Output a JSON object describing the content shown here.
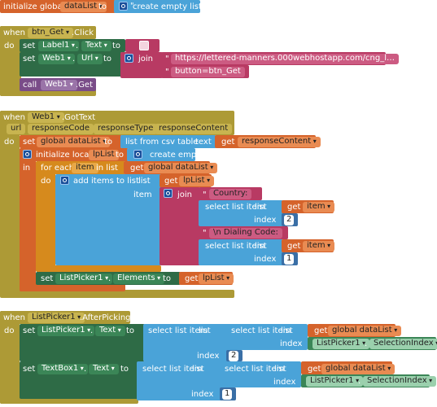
{
  "kw": {
    "initialize_global": "initialize global",
    "to": "to",
    "when": "when",
    "do": "do",
    "set": "set",
    "call": "call",
    "join": "join",
    "get": "get",
    "in": "in",
    "item": "item",
    "index": "index",
    "list": "list",
    "text": "text",
    "for_each": "for each",
    "in_list": "in list",
    "initialize_local": "initialize local",
    "dot": "."
  },
  "block1": {
    "var_name": "dataList",
    "value": "create empty list"
  },
  "block2": {
    "component": "btn_Get",
    "event": ".Click",
    "set1_component": "Label1",
    "set1_prop": "Text",
    "set1_value": "",
    "set2_component": "Web1",
    "set2_prop": "Url",
    "url_text": "https://lettered-manners.000webhostapp.com/cng_l…",
    "button_text": "button=btn_Get",
    "call_component": "Web1",
    "call_method": ".Get"
  },
  "block3": {
    "component": "Web1",
    "event": ".GotText",
    "params": [
      "url",
      "responseCode",
      "responseType",
      "responseContent"
    ],
    "set_var": "global dataList",
    "csv": "list from csv table",
    "get_response": "responseContent",
    "local_name": "lpList",
    "local_value": "create empty list",
    "loop_var": "item",
    "loop_list": "global dataList",
    "add_items": "add items to list",
    "get_lplist": "lpList",
    "country_text": "Country:",
    "select_list_item": "select list item",
    "get_item": "item",
    "index_2": "2",
    "dialing_text": "\\n Dialing Code:",
    "index_1": "1",
    "set_picker": "ListPicker1",
    "set_picker_prop": "Elements",
    "get_lplist2": "lpList"
  },
  "block4": {
    "component": "ListPicker1",
    "event": ".AfterPicking",
    "set1_component": "ListPicker1",
    "set1_prop": "Text",
    "select_list_item": "select list item",
    "get_datalist": "global dataList",
    "picker": "ListPicker1",
    "selection_index": "SelectionIndex",
    "index_2": "2",
    "set2_component": "TextBox1",
    "set2_prop": "Text",
    "index_1": "1"
  }
}
